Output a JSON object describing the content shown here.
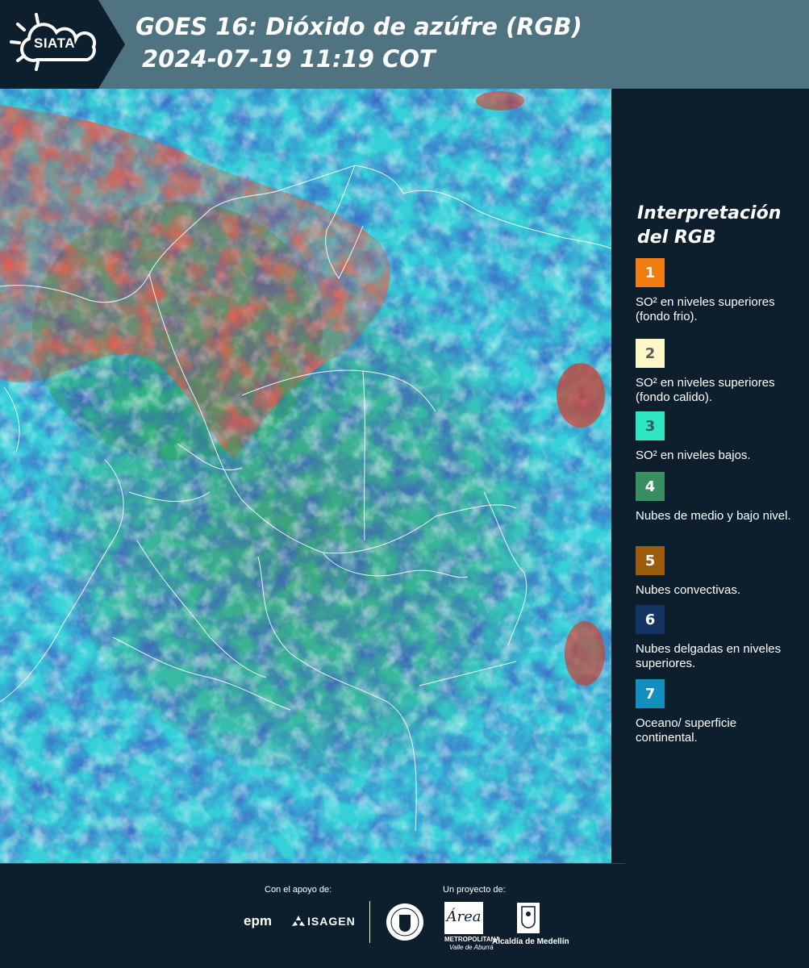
{
  "header": {
    "logo_text": "SIATA",
    "title": "GOES 16: Dióxido de azúfre (RGB)",
    "subtitle": "2024-07-19 11:19 COT"
  },
  "legend": {
    "title": "Interpretación del RGB",
    "items": [
      {
        "number": "1",
        "label": "SO² en niveles superiores (fondo frio).",
        "color": "#f07d12",
        "text_color": "#ffffff"
      },
      {
        "number": "2",
        "label": "SO² en niveles superiores (fondo calido).",
        "color": "#fdf8c7",
        "text_color": "#5a5a5a"
      },
      {
        "number": "3",
        "label": "SO² en niveles bajos.",
        "color": "#2ee6c3",
        "text_color": "#2f5f58"
      },
      {
        "number": "4",
        "label": "Nubes de medio y bajo nivel.",
        "color": "#3a8f60",
        "text_color": "#ffffff"
      },
      {
        "number": "5",
        "label": "Nubes convectivas.",
        "color": "#9a5c0c",
        "text_color": "#ffffff"
      },
      {
        "number": "6",
        "label": "Nubes delgadas en niveles superiores.",
        "color": "#143463",
        "text_color": "#ffffff"
      },
      {
        "number": "7",
        "label": "Oceano/ superficie continental.",
        "color": "#1390bf",
        "text_color": "#ffffff"
      }
    ]
  },
  "footer": {
    "support_label": "Con el apoyo de:",
    "project_label": "Un proyecto de:",
    "sponsors": [
      "epm",
      "ISAGEN"
    ],
    "partner_caption": "METROPOLITANA",
    "partner_caption2": "Valle de Aburrá",
    "partner_script": "Área",
    "city_caption": "Alcaldía de Medellín"
  }
}
